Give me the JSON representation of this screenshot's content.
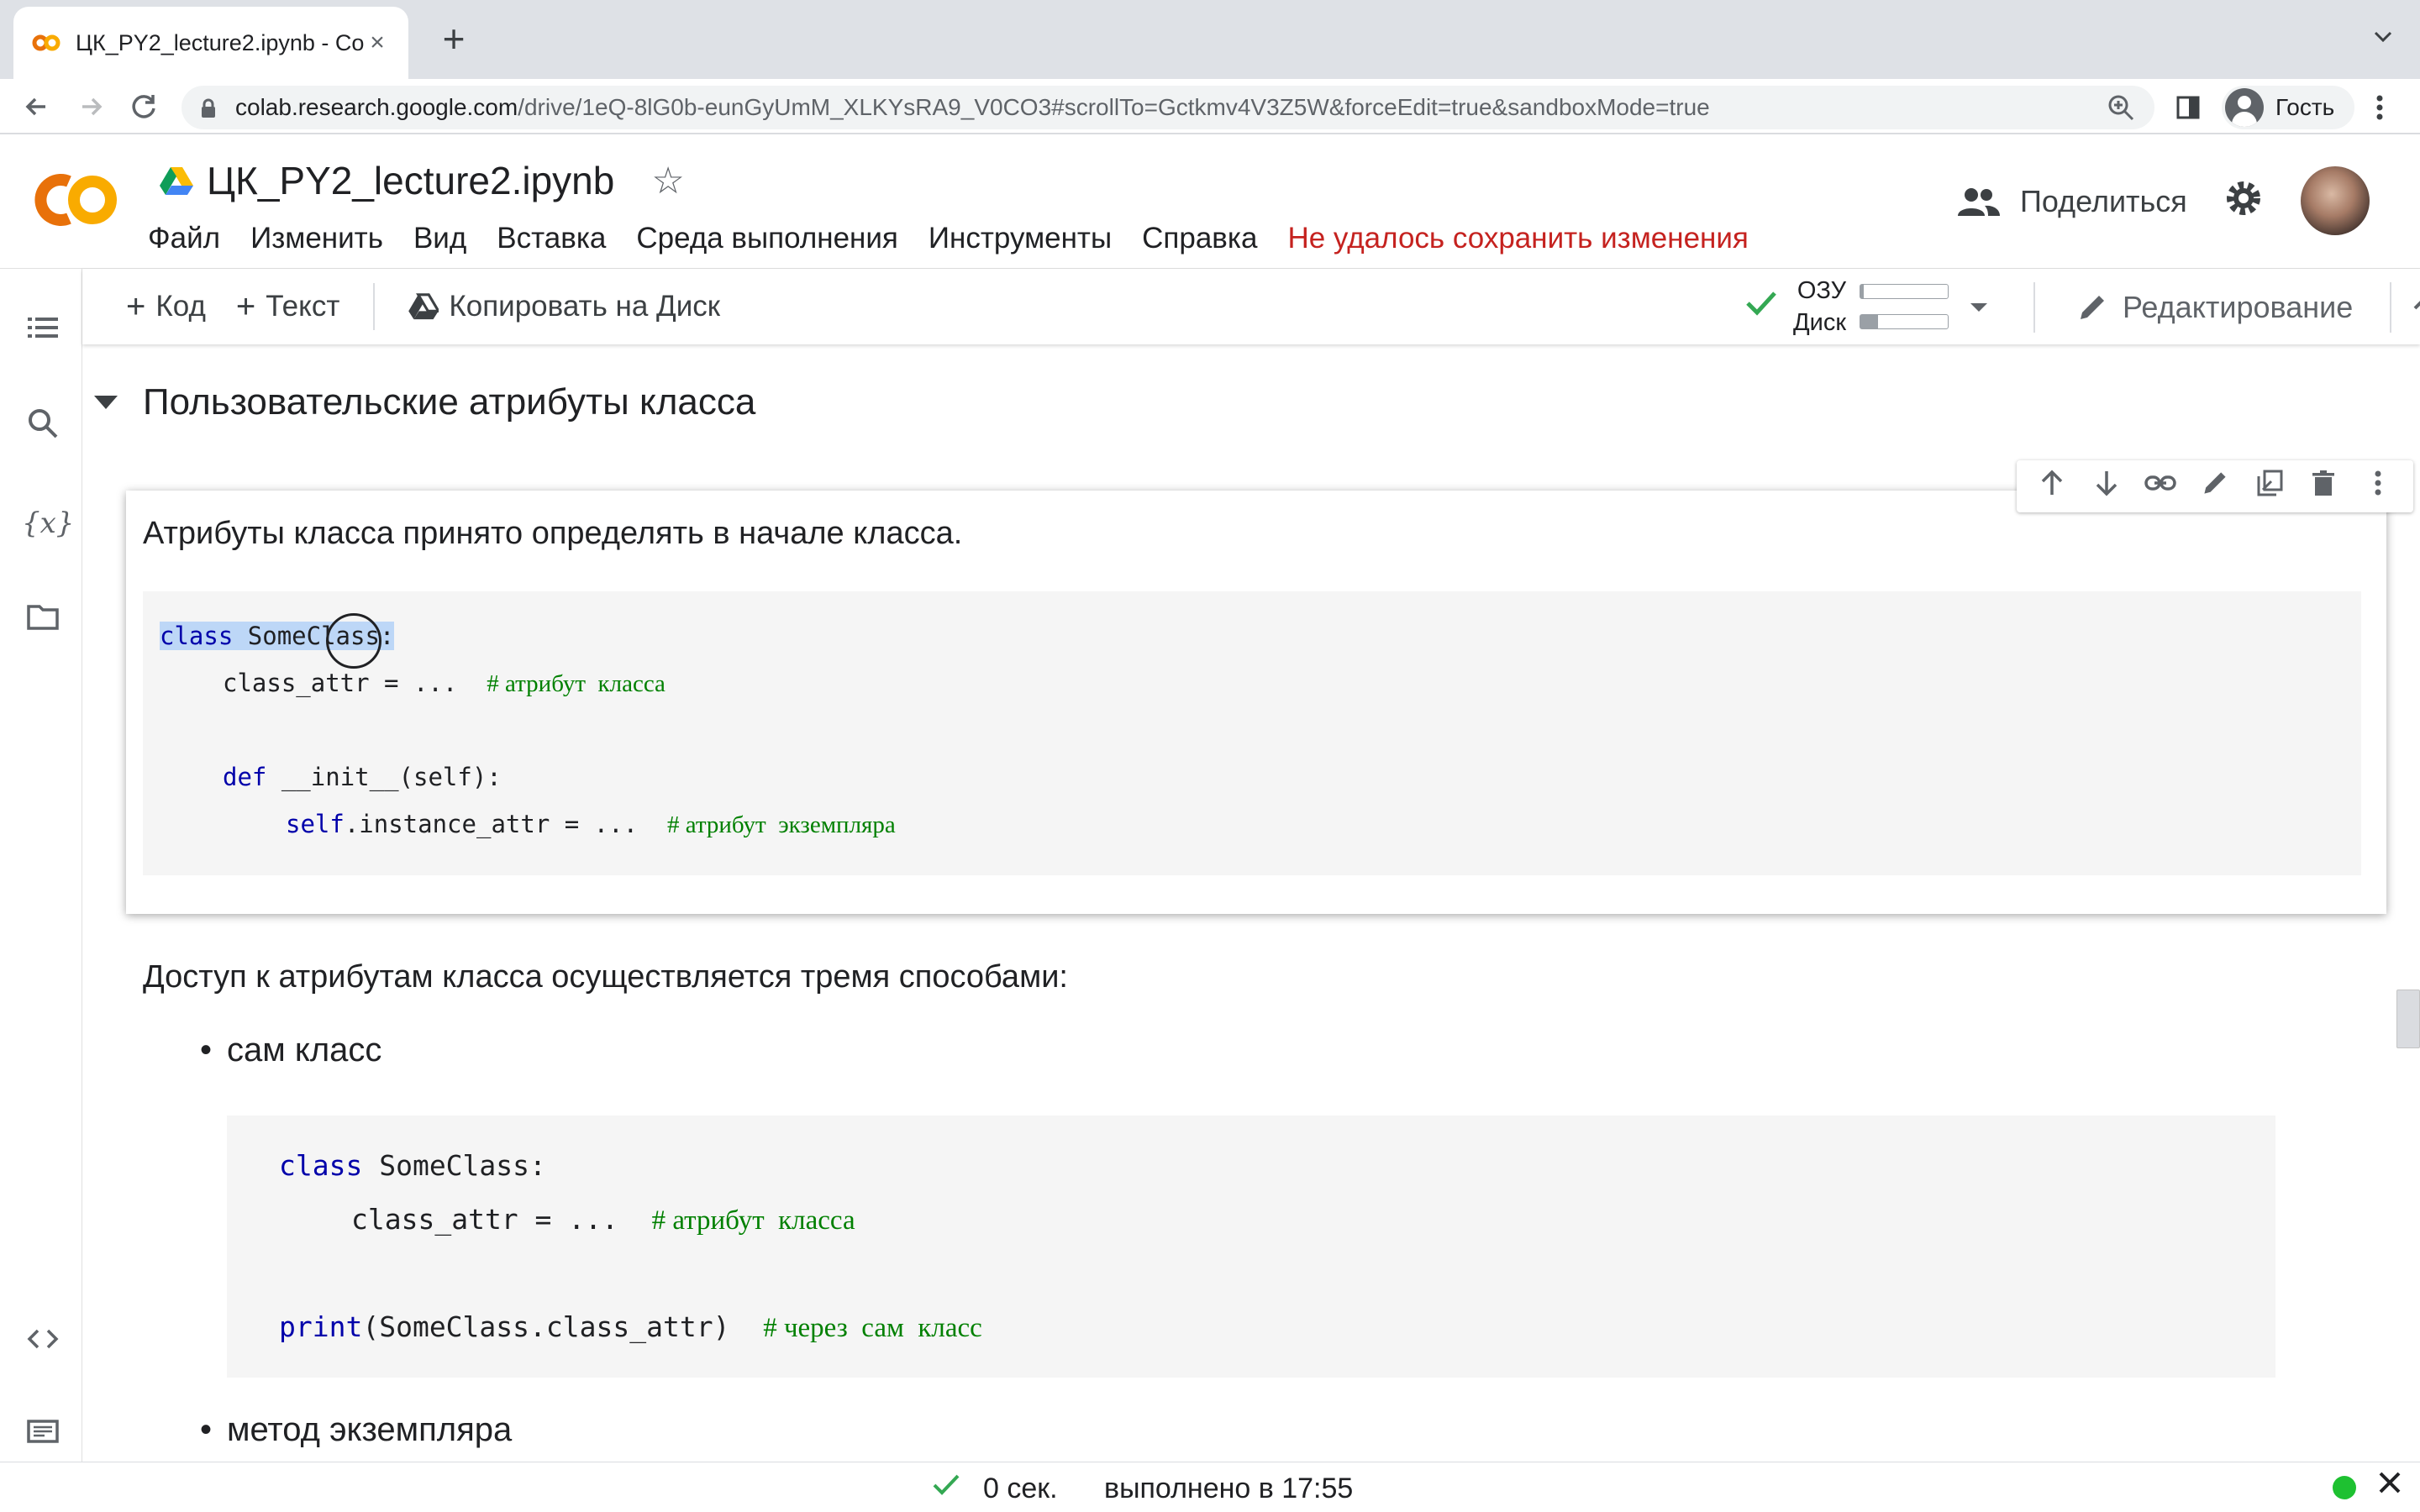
{
  "browser": {
    "tab_title": "ЦК_PY2_lecture2.ipynb - Colab",
    "url_domain": "colab.research.google.com",
    "url_path": "/drive/1eQ-8lG0b-eunGyUmM_XLKYsRA9_V0CO3#scrollTo=Gctkmv4V3Z5W&forceEdit=true&sandboxMode=true",
    "profile_label": "Гость"
  },
  "colab": {
    "logo_text": "CO",
    "notebook_title": "ЦК_PY2_lecture2.ipynb",
    "menu": [
      "Файл",
      "Изменить",
      "Вид",
      "Вставка",
      "Среда выполнения",
      "Инструменты",
      "Справка"
    ],
    "save_error": "Не удалось сохранить изменения",
    "share_label": "Поделиться"
  },
  "toolbar": {
    "code_label": "Код",
    "text_label": "Текст",
    "copy_label": "Копировать на Диск",
    "ram_label": "ОЗУ",
    "disk_label": "Диск",
    "ram_fraction": 0.04,
    "disk_fraction": 0.2,
    "edit_label": "Редактирование"
  },
  "content": {
    "section_title": "Пользовательские атрибуты класса",
    "cell_text": "Атрибуты класса принято определять в начале класса.",
    "code1": {
      "l1_kw": "class",
      "l1_name": " SomeClass:",
      "l2": "class_attr = ...",
      "l2_cm": "# атрибут  класса",
      "l4_kw": "def",
      "l4_rest": " __init__(self):",
      "l5_kw": "self",
      "l5_rest": ".instance_attr = ...",
      "l5_cm": "# атрибут  экземпляра"
    },
    "access_text": "Доступ к атрибутам класса осуществляется тремя способами:",
    "bullet1": "сам класс",
    "code2": {
      "l1_kw": "class",
      "l1_name": " SomeClass:",
      "l2": "class_attr = ...",
      "l2_cm": "# атрибут  класса",
      "l4_kw": "print",
      "l4_rest": "(SomeClass.class_attr)",
      "l4_cm": "# через  сам  класс"
    },
    "bullet2": "метод экземпляра"
  },
  "status": {
    "duration": "0 сек.",
    "completed": "выполнено в 17:55"
  },
  "colors": {
    "accent_green": "#34a853",
    "error_red": "#c5221f",
    "keyword_blue": "#0000aa",
    "comment_green": "#008000"
  }
}
